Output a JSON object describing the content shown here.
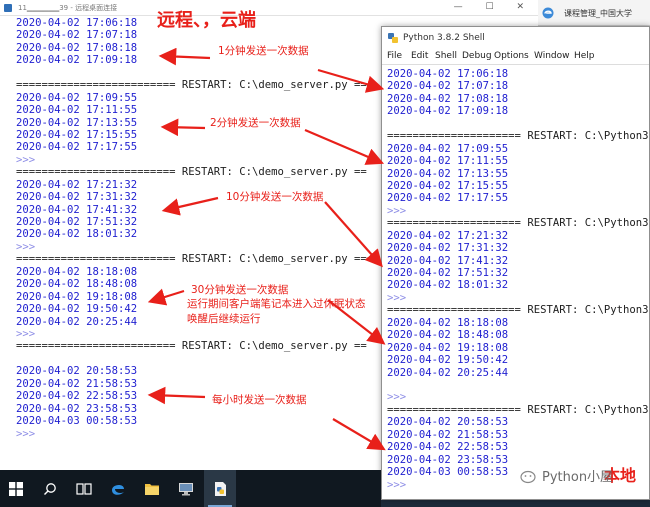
{
  "remote_window": {
    "title": "11▁▁▁▁▁▁39 - 远程桌面连接",
    "controls": "— ☐ ✕"
  },
  "remote_console": {
    "lines": [
      {
        "text": "2020-04-02 17:06:18",
        "kind": "blue"
      },
      {
        "text": "2020-04-02 17:07:18",
        "kind": "blue"
      },
      {
        "text": "2020-04-02 17:08:18",
        "kind": "blue"
      },
      {
        "text": "2020-04-02 17:09:18",
        "kind": "blue"
      },
      {
        "text": "",
        "kind": "blue"
      },
      {
        "text": "========================= RESTART: C:\\demo_server.py ==",
        "kind": "dark"
      },
      {
        "text": "2020-04-02 17:09:55",
        "kind": "blue"
      },
      {
        "text": "2020-04-02 17:11:55",
        "kind": "blue"
      },
      {
        "text": "2020-04-02 17:13:55",
        "kind": "blue"
      },
      {
        "text": "2020-04-02 17:15:55",
        "kind": "blue"
      },
      {
        "text": "2020-04-02 17:17:55",
        "kind": "blue"
      },
      {
        "text": ">>>",
        "kind": "prompt"
      },
      {
        "text": "========================= RESTART: C:\\demo_server.py ==",
        "kind": "dark"
      },
      {
        "text": "2020-04-02 17:21:32",
        "kind": "blue"
      },
      {
        "text": "2020-04-02 17:31:32",
        "kind": "blue"
      },
      {
        "text": "2020-04-02 17:41:32",
        "kind": "blue"
      },
      {
        "text": "2020-04-02 17:51:32",
        "kind": "blue"
      },
      {
        "text": "2020-04-02 18:01:32",
        "kind": "blue"
      },
      {
        "text": ">>>",
        "kind": "prompt"
      },
      {
        "text": "========================= RESTART: C:\\demo_server.py ==",
        "kind": "dark"
      },
      {
        "text": "2020-04-02 18:18:08",
        "kind": "blue"
      },
      {
        "text": "2020-04-02 18:48:08",
        "kind": "blue"
      },
      {
        "text": "2020-04-02 19:18:08",
        "kind": "blue"
      },
      {
        "text": "2020-04-02 19:50:42",
        "kind": "blue"
      },
      {
        "text": "2020-04-02 20:25:44",
        "kind": "blue"
      },
      {
        "text": ">>>",
        "kind": "prompt"
      },
      {
        "text": "========================= RESTART: C:\\demo_server.py ==",
        "kind": "dark"
      },
      {
        "text": "",
        "kind": "blue"
      },
      {
        "text": "2020-04-02 20:58:53",
        "kind": "blue"
      },
      {
        "text": "2020-04-02 21:58:53",
        "kind": "blue"
      },
      {
        "text": "2020-04-02 22:58:53",
        "kind": "blue"
      },
      {
        "text": "2020-04-02 23:58:53",
        "kind": "blue"
      },
      {
        "text": "2020-04-03 00:58:53",
        "kind": "blue"
      },
      {
        "text": ">>>",
        "kind": "prompt"
      }
    ]
  },
  "python_shell": {
    "title": "Python 3.8.2 Shell",
    "menu": [
      "File",
      "Edit",
      "Shell",
      "Debug",
      "Options",
      "Window",
      "Help"
    ],
    "lines": [
      {
        "text": "2020-04-02 17:06:18",
        "kind": "blue"
      },
      {
        "text": "2020-04-02 17:07:18",
        "kind": "blue"
      },
      {
        "text": "2020-04-02 17:08:18",
        "kind": "blue"
      },
      {
        "text": "2020-04-02 17:09:18",
        "kind": "blue"
      },
      {
        "text": "",
        "kind": "blue"
      },
      {
        "text": "===================== RESTART: C:\\Python38\\",
        "kind": "dark"
      },
      {
        "text": "2020-04-02 17:09:55",
        "kind": "blue"
      },
      {
        "text": "2020-04-02 17:11:55",
        "kind": "blue"
      },
      {
        "text": "2020-04-02 17:13:55",
        "kind": "blue"
      },
      {
        "text": "2020-04-02 17:15:55",
        "kind": "blue"
      },
      {
        "text": "2020-04-02 17:17:55",
        "kind": "blue"
      },
      {
        "text": ">>>",
        "kind": "prompt"
      },
      {
        "text": "===================== RESTART: C:\\Python38\\",
        "kind": "dark"
      },
      {
        "text": "2020-04-02 17:21:32",
        "kind": "blue"
      },
      {
        "text": "2020-04-02 17:31:32",
        "kind": "blue"
      },
      {
        "text": "2020-04-02 17:41:32",
        "kind": "blue"
      },
      {
        "text": "2020-04-02 17:51:32",
        "kind": "blue"
      },
      {
        "text": "2020-04-02 18:01:32",
        "kind": "blue"
      },
      {
        "text": ">>>",
        "kind": "prompt"
      },
      {
        "text": "===================== RESTART: C:\\Python38\\",
        "kind": "dark"
      },
      {
        "text": "2020-04-02 18:18:08",
        "kind": "blue"
      },
      {
        "text": "2020-04-02 18:48:08",
        "kind": "blue"
      },
      {
        "text": "2020-04-02 19:18:08",
        "kind": "blue"
      },
      {
        "text": "2020-04-02 19:50:42",
        "kind": "blue"
      },
      {
        "text": "2020-04-02 20:25:44",
        "kind": "blue"
      },
      {
        "text": "",
        "kind": "blue"
      },
      {
        "text": ">>>",
        "kind": "prompt"
      },
      {
        "text": "===================== RESTART: C:\\Python38\\",
        "kind": "dark"
      },
      {
        "text": "2020-04-02 20:58:53",
        "kind": "blue"
      },
      {
        "text": "2020-04-02 21:58:53",
        "kind": "blue"
      },
      {
        "text": "2020-04-02 22:58:53",
        "kind": "blue"
      },
      {
        "text": "2020-04-02 23:58:53",
        "kind": "blue"
      },
      {
        "text": "2020-04-03 00:58:53",
        "kind": "blue"
      },
      {
        "text": ">>>",
        "kind": "prompt"
      }
    ]
  },
  "browser_tab": {
    "text": "课程管理_中国大学"
  },
  "annotations": {
    "heading": "远程、，云端",
    "interval_1min": "1分钟发送一次数据",
    "interval_2min": "2分钟发送一次数据",
    "interval_10min": "10分钟发送一次数据",
    "interval_30min": "30分钟发送一次数据",
    "sleep_note": "运行期间客户端笔记本进入过休眠状态",
    "resume_note": "唤醒后继续运行",
    "interval_hour": "每小时发送一次数据",
    "local_label": "本地"
  },
  "watermark": {
    "text": "Python小屋"
  },
  "taskbar": {
    "items": [
      "windows-start-icon",
      "search-icon",
      "task-view-icon",
      "edge-browser-icon",
      "file-explorer-icon",
      "remote-desktop-icon",
      "python-idle-icon"
    ]
  },
  "colors": {
    "console_blue": "#1f1fd0",
    "annotation_red": "#e8201a",
    "taskbar_bg": "#101820"
  }
}
